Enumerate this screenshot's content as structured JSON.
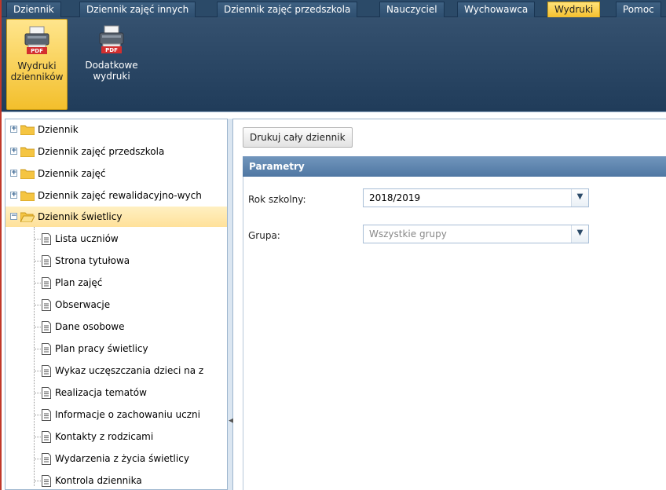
{
  "menu": {
    "tabs": [
      {
        "label": "Dziennik"
      },
      {
        "label": "Dziennik zajęć innych"
      },
      {
        "label": "Dziennik zajęć przedszkola"
      },
      {
        "label": "Nauczyciel"
      },
      {
        "label": "Wychowawca"
      },
      {
        "label": "Wydruki"
      },
      {
        "label": "Pomoc"
      }
    ]
  },
  "toolbar": {
    "buttons": [
      {
        "label": "Wydruki\ndzienników",
        "badge": "PDF"
      },
      {
        "label": "Dodatkowe\nwydruki",
        "badge": "PDF"
      }
    ]
  },
  "tree": {
    "folders": [
      {
        "label": "Dziennik",
        "toggle": "+"
      },
      {
        "label": "Dziennik zajęć przedszkola",
        "toggle": "+"
      },
      {
        "label": "Dziennik zajęć",
        "toggle": "+"
      },
      {
        "label": "Dziennik zajęć rewalidacyjno-wych",
        "toggle": "+"
      },
      {
        "label": "Dziennik świetlicy",
        "toggle": "−"
      }
    ],
    "children": [
      {
        "label": "Lista uczniów"
      },
      {
        "label": "Strona tytułowa"
      },
      {
        "label": "Plan zajęć"
      },
      {
        "label": "Obserwacje"
      },
      {
        "label": "Dane osobowe"
      },
      {
        "label": "Plan pracy świetlicy"
      },
      {
        "label": "Wykaz uczęszczania dzieci na z"
      },
      {
        "label": "Realizacja tematów"
      },
      {
        "label": "Informacje o zachowaniu uczni"
      },
      {
        "label": "Kontakty z rodzicami"
      },
      {
        "label": "Wydarzenia z życia świetlicy"
      },
      {
        "label": "Kontrola dziennika"
      }
    ]
  },
  "main": {
    "print_all_label": "Drukuj cały dziennik",
    "params_title": "Parametry",
    "fields": [
      {
        "label": "Rok szkolny:",
        "value": "2018/2019"
      },
      {
        "label": "Grupa:",
        "value": "Wszystkie grupy"
      }
    ]
  },
  "colors": {
    "accent": "#f5c02e",
    "header": "#2b4a68",
    "param_header": "#5a80aa"
  }
}
